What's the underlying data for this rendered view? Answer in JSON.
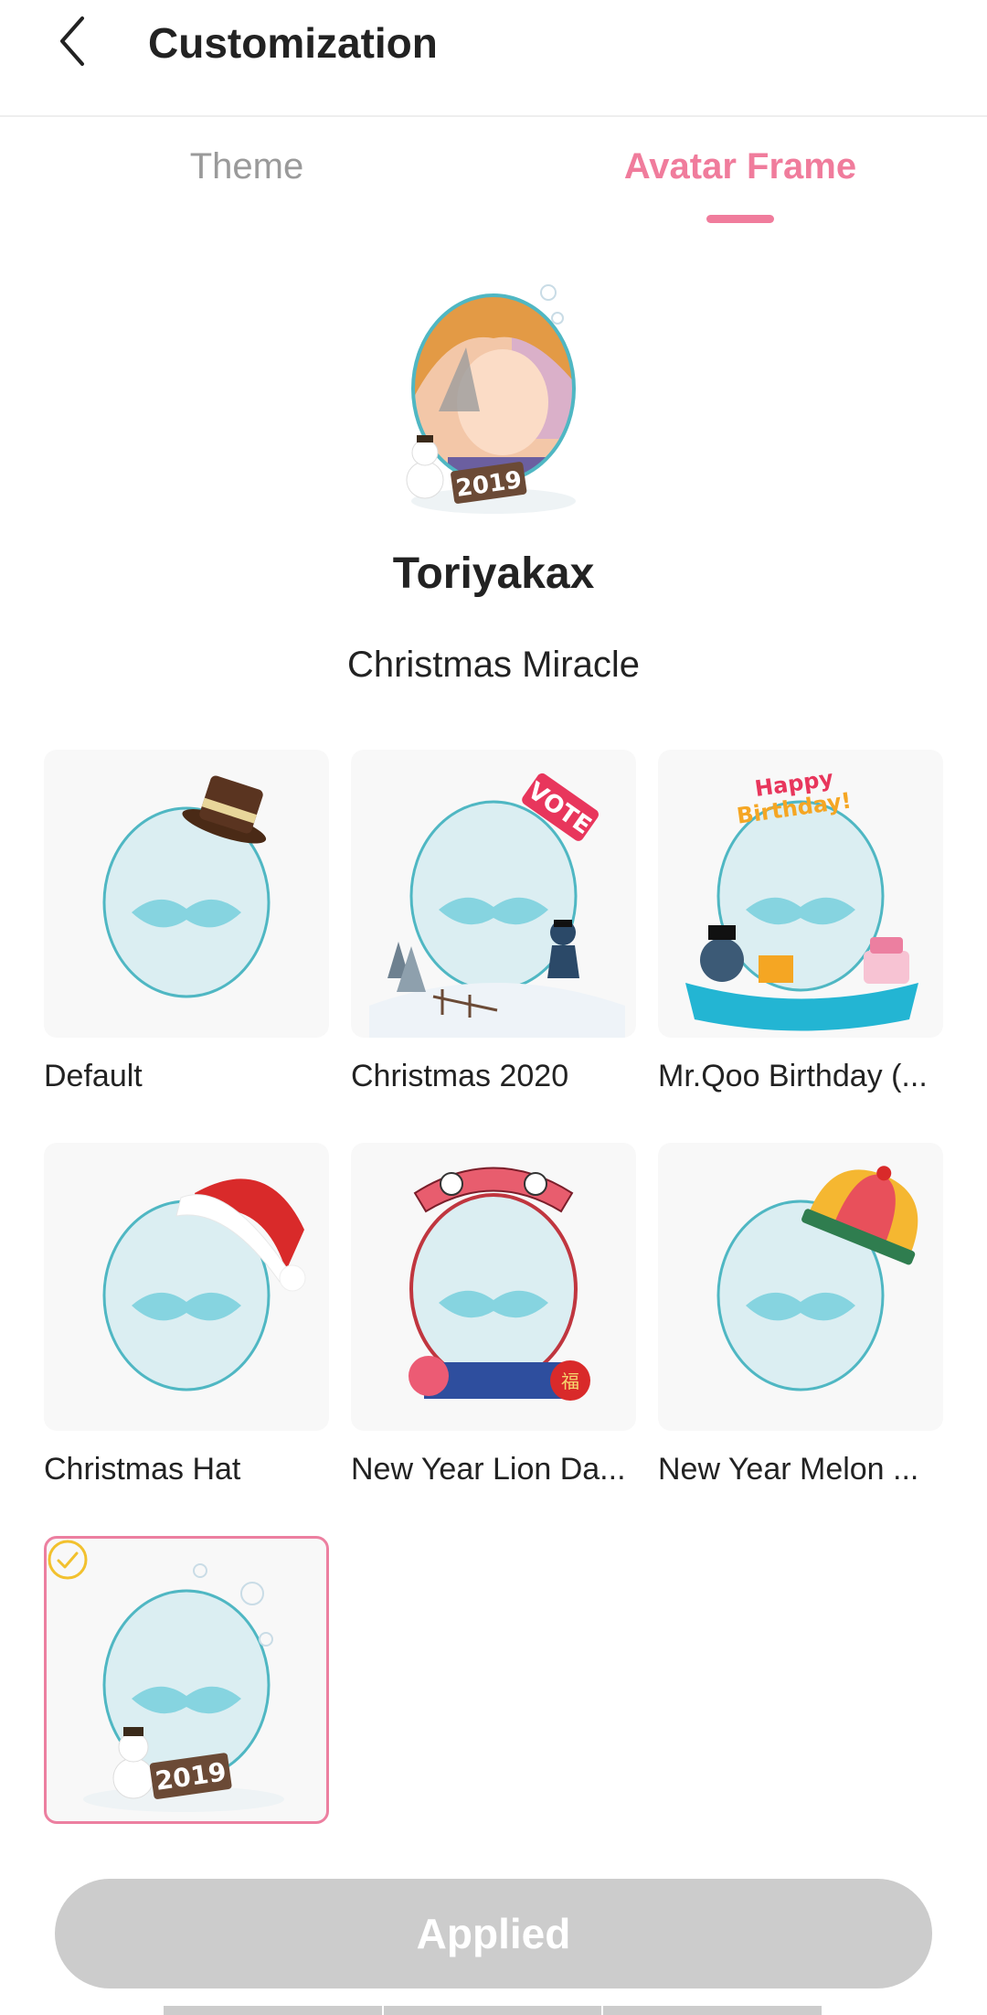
{
  "header": {
    "title": "Customization",
    "back_icon": "chevron-left-icon"
  },
  "tabs": [
    {
      "label": "Theme",
      "active": false
    },
    {
      "label": "Avatar Frame",
      "active": true
    }
  ],
  "profile": {
    "username": "Toriyakax",
    "current_frame": "Christmas Miracle"
  },
  "frames": [
    {
      "label": "Default"
    },
    {
      "label": "Christmas 2020"
    },
    {
      "label": "Mr.Qoo Birthday (..."
    },
    {
      "label": "Christmas Hat"
    },
    {
      "label": "New Year Lion Da..."
    },
    {
      "label": "New Year Melon ..."
    },
    {
      "label": "",
      "selected": true,
      "badge_text": "2019"
    }
  ],
  "preview_badge_text": "2019",
  "apply_button": {
    "label": "Applied"
  },
  "colors": {
    "accent": "#f07c9c",
    "inactive_tab": "#9a9a9a",
    "button_disabled": "#cccccc",
    "check": "#f2c12e"
  }
}
